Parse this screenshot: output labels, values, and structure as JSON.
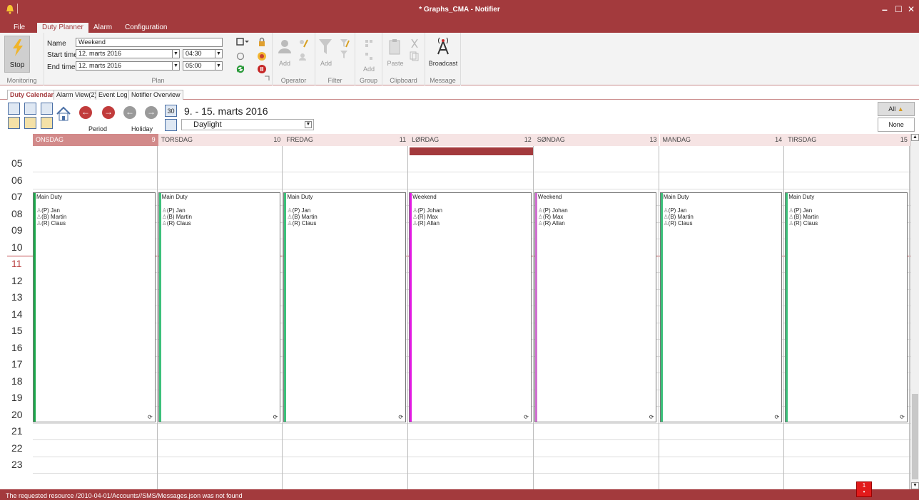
{
  "window": {
    "title": "* Graphs_CMA - Notifier",
    "min": "–",
    "max": "☐",
    "close": "✕"
  },
  "menu": {
    "file": "File",
    "duty_planner": "Duty Planner",
    "alarm": "Alarm",
    "configuration": "Configuration"
  },
  "ribbon": {
    "monitoring": {
      "stop_label": "Stop",
      "group": "Monitoring"
    },
    "plan": {
      "name_label": "Name",
      "name_value": "Weekend",
      "start_label": "Start time",
      "start_date": "12.  marts  2016",
      "start_time": "04:30",
      "end_label": "End time",
      "end_date": "12.  marts  2016",
      "end_time": "05:00",
      "group": "Plan"
    },
    "operator": {
      "add": "Add",
      "group": "Operator"
    },
    "filter": {
      "add": "Add",
      "group": "Filter"
    },
    "group": {
      "add": "Add",
      "group": "Group"
    },
    "clipboard": {
      "paste": "Paste",
      "group": "Clipboard"
    },
    "message": {
      "broadcast": "Broadcast",
      "group": "Message"
    }
  },
  "view_tabs": [
    "Duty Calendar",
    "Alarm View(2)",
    "Event Log",
    "Notifier Overview"
  ],
  "toolbar": {
    "period": "Period",
    "holiday": "Holiday",
    "date_range": "9. - 15. marts 2016",
    "calendar_num": "30",
    "shift_filter": "Daylight",
    "all": "All",
    "none": "None"
  },
  "days": [
    {
      "name": "ONSDAG",
      "num": "9"
    },
    {
      "name": "TORSDAG",
      "num": "10"
    },
    {
      "name": "FREDAG",
      "num": "11"
    },
    {
      "name": "LØRDAG",
      "num": "12"
    },
    {
      "name": "SØNDAG",
      "num": "13"
    },
    {
      "name": "MANDAG",
      "num": "14"
    },
    {
      "name": "TIRSDAG",
      "num": "15"
    }
  ],
  "hours": [
    "05",
    "06",
    "07",
    "08",
    "09",
    "10",
    "11",
    "12",
    "13",
    "14",
    "15",
    "16",
    "17",
    "18",
    "19",
    "20",
    "21",
    "22",
    "23"
  ],
  "duties": [
    {
      "name": "Main Duty",
      "members": [
        "(P) Jan",
        "(B) Martin",
        "(R) Claus"
      ],
      "color": "#1aa84a"
    },
    {
      "name": "Main Duty",
      "members": [
        "(P) Jan",
        "(B) Martin",
        "(R) Claus"
      ],
      "color": "#3cc07a"
    },
    {
      "name": "Main Duty",
      "members": [
        "(P) Jan",
        "(B) Martin",
        "(R) Claus"
      ],
      "color": "#3cc07a"
    },
    {
      "name": "Weekend",
      "members": [
        "(P) Johan",
        "(R) Max",
        "(R) Allan"
      ],
      "color": "#e21be2"
    },
    {
      "name": "Weekend",
      "members": [
        "(P) Johan",
        "(R) Max",
        "(R) Allan"
      ],
      "color": "#d070d0"
    },
    {
      "name": "Main Duty",
      "members": [
        "(P) Jan",
        "(B) Martin",
        "(R) Claus"
      ],
      "color": "#3cc07a"
    },
    {
      "name": "Main Duty",
      "members": [
        "(P) Jan",
        "(B) Martin",
        "(R) Claus"
      ],
      "color": "#3cc07a"
    }
  ],
  "status": {
    "message": "The requested resource /2010-04-01/Accounts//SMS/Messages.json was not found",
    "badge": "1"
  },
  "colors": {
    "accent": "#a33a3d",
    "today": "#d28a8a"
  }
}
